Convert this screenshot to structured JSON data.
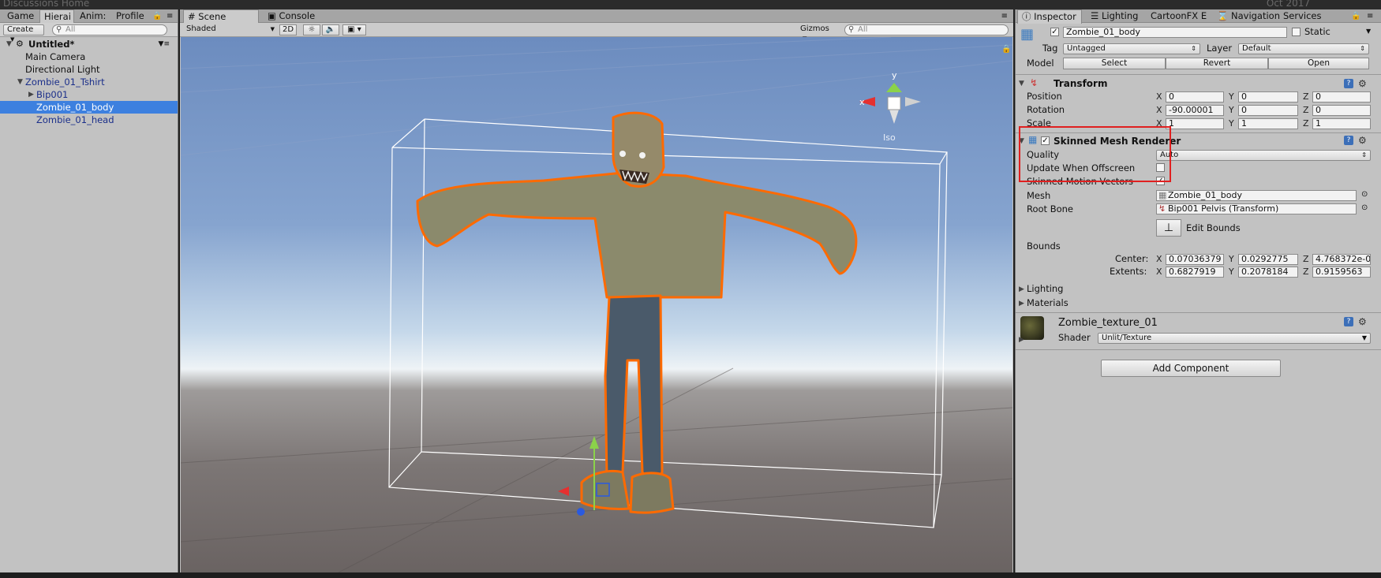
{
  "window": {
    "title_fragment": "Discussions Home",
    "date_fragment": "Oct 2017"
  },
  "hierarchy": {
    "tabs": [
      "Game",
      "Hierai",
      "Anim:",
      "Profile"
    ],
    "create_label": "Create",
    "search_placeholder": "All",
    "scene_name": "Untitled*",
    "items": [
      "Main Camera",
      "Directional Light",
      "Zombie_01_Tshirt",
      "Bip001",
      "Zombie_01_body",
      "Zombie_01_head"
    ],
    "selected": "Zombie_01_body"
  },
  "scene": {
    "tabs": [
      "Scene",
      "Console"
    ],
    "shading_mode": "Shaded",
    "mode_2d": "2D",
    "gizmos_label": "Gizmos",
    "search_placeholder": "All",
    "gizmo_axes": {
      "x": "x",
      "y": "y"
    },
    "projection_label": "Iso"
  },
  "inspector": {
    "tabs": [
      "Inspector",
      "Lighting",
      "CartoonFX E",
      "Navigation",
      "Services"
    ],
    "object_name": "Zombie_01_body",
    "static_label": "Static",
    "tag_label": "Tag",
    "tag_value": "Untagged",
    "layer_label": "Layer",
    "layer_value": "Default",
    "model_label": "Model",
    "model_buttons": [
      "Select",
      "Revert",
      "Open"
    ],
    "transform": {
      "title": "Transform",
      "position_label": "Position",
      "position": [
        "0",
        "0",
        "0"
      ],
      "rotation_label": "Rotation",
      "rotation": [
        "-90.00001",
        "0",
        "0"
      ],
      "scale_label": "Scale",
      "scale": [
        "1",
        "1",
        "1"
      ]
    },
    "smr": {
      "title": "Skinned Mesh Renderer",
      "quality_label": "Quality",
      "quality_value": "Auto",
      "update_offscreen_label": "Update When Offscreen",
      "update_offscreen": false,
      "motion_vectors_label": "Skinned Motion Vectors",
      "motion_vectors": true,
      "mesh_label": "Mesh",
      "mesh_value": "Zombie_01_body",
      "root_bone_label": "Root Bone",
      "root_bone_value": "Bip001 Pelvis (Transform)",
      "edit_bounds_label": "Edit Bounds",
      "bounds_label": "Bounds",
      "center_label": "Center:",
      "center": [
        "0.07036379",
        "0.0292775",
        "4.768372e-0"
      ],
      "extents_label": "Extents:",
      "extents": [
        "0.6827919",
        "0.2078184",
        "0.9159563"
      ],
      "lighting_label": "Lighting",
      "materials_label": "Materials"
    },
    "material": {
      "name": "Zombie_texture_01",
      "shader_label": "Shader",
      "shader_value": "Unlit/Texture"
    },
    "add_component_label": "Add Component",
    "axis_labels": [
      "X",
      "Y",
      "Z"
    ]
  },
  "colors": {
    "selection": "#3d80df",
    "highlight_box": "#e02020",
    "outline": "#ff6a00"
  }
}
